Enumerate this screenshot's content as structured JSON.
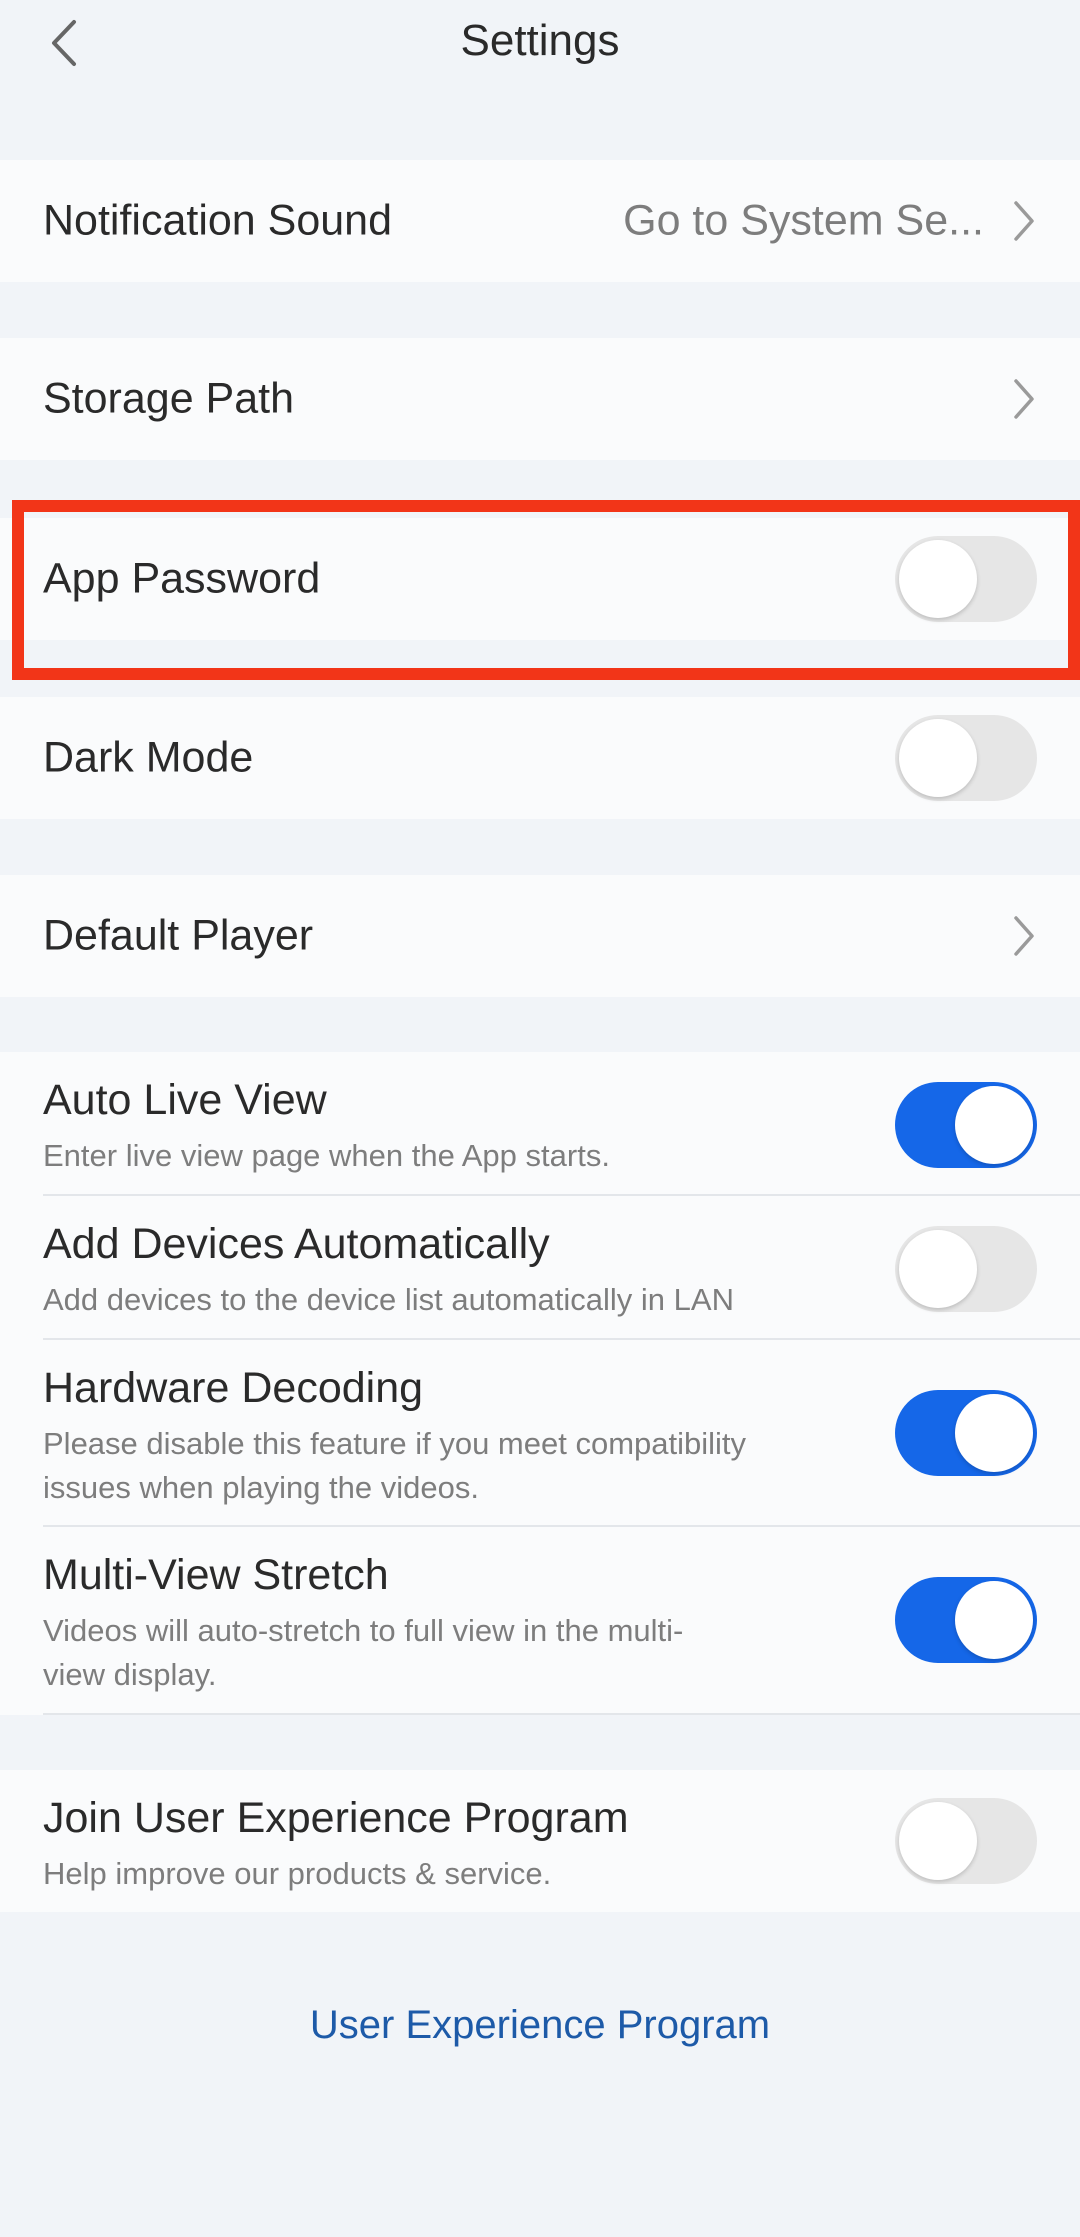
{
  "header": {
    "title": "Settings",
    "back_icon": "chevron-left-icon"
  },
  "rows": {
    "notification_sound": {
      "label": "Notification Sound",
      "value": "Go to System Se...",
      "icon": "chevron-right-icon"
    },
    "storage_path": {
      "label": "Storage Path",
      "icon": "chevron-right-icon"
    },
    "app_password": {
      "label": "App Password",
      "enabled": false,
      "highlighted": true
    },
    "dark_mode": {
      "label": "Dark Mode",
      "enabled": false
    },
    "default_player": {
      "label": "Default Player",
      "icon": "chevron-right-icon"
    },
    "auto_live_view": {
      "label": "Auto Live View",
      "description": "Enter live view page when the App starts.",
      "enabled": true
    },
    "add_devices_automatically": {
      "label": "Add Devices Automatically",
      "description": "Add devices to the device list automatically in LAN",
      "enabled": false
    },
    "hardware_decoding": {
      "label": "Hardware Decoding",
      "description": "Please disable this feature if you meet compatibility issues when playing the videos.",
      "enabled": true
    },
    "multi_view_stretch": {
      "label": "Multi-View Stretch",
      "description": "Videos will auto-stretch to full view in the multi-view display.",
      "enabled": true
    },
    "join_user_experience_program": {
      "label": "Join User Experience Program",
      "description": "Help improve our products & service.",
      "enabled": false
    }
  },
  "footer": {
    "link_label": "User Experience Program"
  },
  "colors": {
    "accent": "#1567e8",
    "highlight_box": "#f23518",
    "link": "#1d5aa8",
    "background": "#f1f4f8"
  }
}
